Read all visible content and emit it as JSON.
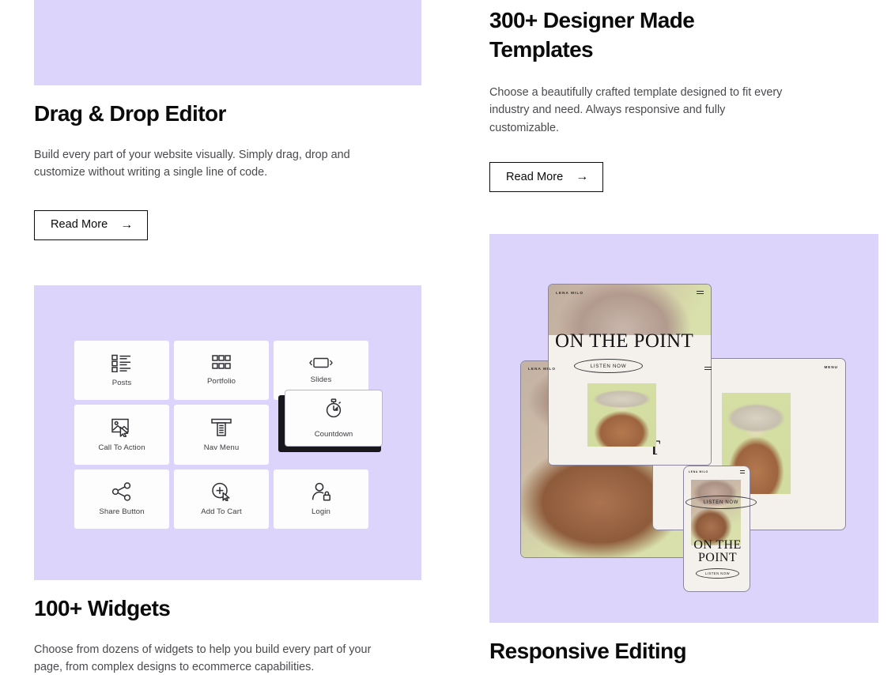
{
  "theme": {
    "purple_panel": "#DCD4FA",
    "card_white": "#FDFDFD",
    "text_dark": "#0B0B0B",
    "text_body": "#4A4A4F",
    "mock_paper": "#F4F1ED",
    "mock_green": "#D9E0AB",
    "shadow_dark": "#17171C"
  },
  "features": [
    {
      "id": "drag-drop-editor",
      "title": "Drag & Drop Editor",
      "body": "Build every part of your website visually. Simply drag, drop and customize without writing a single line of code.",
      "cta": {
        "label": "Read More",
        "icon": "arrow-right-icon",
        "glyph": "→"
      }
    },
    {
      "id": "designer-made-templates",
      "title": "300+ Designer Made Templates",
      "body": "Choose a beautifully crafted template designed to fit every industry and need. Always responsive and fully customizable.",
      "cta": {
        "label": "Read More",
        "icon": "arrow-right-icon",
        "glyph": "→"
      }
    },
    {
      "id": "widgets",
      "title": "100+ Widgets",
      "body": "Choose from dozens of widgets to help you build every part of your page, from complex designs to ecommerce capabilities."
    },
    {
      "id": "responsive-editing",
      "title": "Responsive Editing"
    }
  ],
  "widgets": {
    "cells": [
      {
        "label": "Posts",
        "icon": "posts-list-icon"
      },
      {
        "label": "Portfolio",
        "icon": "grid-squares-icon"
      },
      {
        "label": "Slides",
        "icon": "slides-carousel-icon"
      },
      {
        "label": "Call To Action",
        "icon": "image-cursor-icon"
      },
      {
        "label": "Nav Menu",
        "icon": "nav-menu-icon"
      },
      {
        "label": "",
        "icon": ""
      },
      {
        "label": "Share Button",
        "icon": "share-nodes-icon"
      },
      {
        "label": "Add To Cart",
        "icon": "plus-cart-cursor-icon"
      },
      {
        "label": "Login",
        "icon": "user-lock-icon"
      }
    ],
    "raised": {
      "label": "Countdown",
      "icon": "stopwatch-icon"
    }
  },
  "mockups": {
    "brand": "LENA MILO",
    "headline_line1": "ON THE",
    "headline_line2": "POINT",
    "headline_full": "ON THE POINT",
    "headline_partial": "OINT",
    "button": "LISTEN NOW",
    "menu_word": "MENU",
    "menu_icon": "hamburger-menu-icon",
    "frames": [
      {
        "name": "tablet-left",
        "device": "tablet"
      },
      {
        "name": "tablet-right",
        "device": "tablet"
      },
      {
        "name": "desktop",
        "device": "desktop"
      },
      {
        "name": "phone",
        "device": "mobile"
      }
    ]
  }
}
